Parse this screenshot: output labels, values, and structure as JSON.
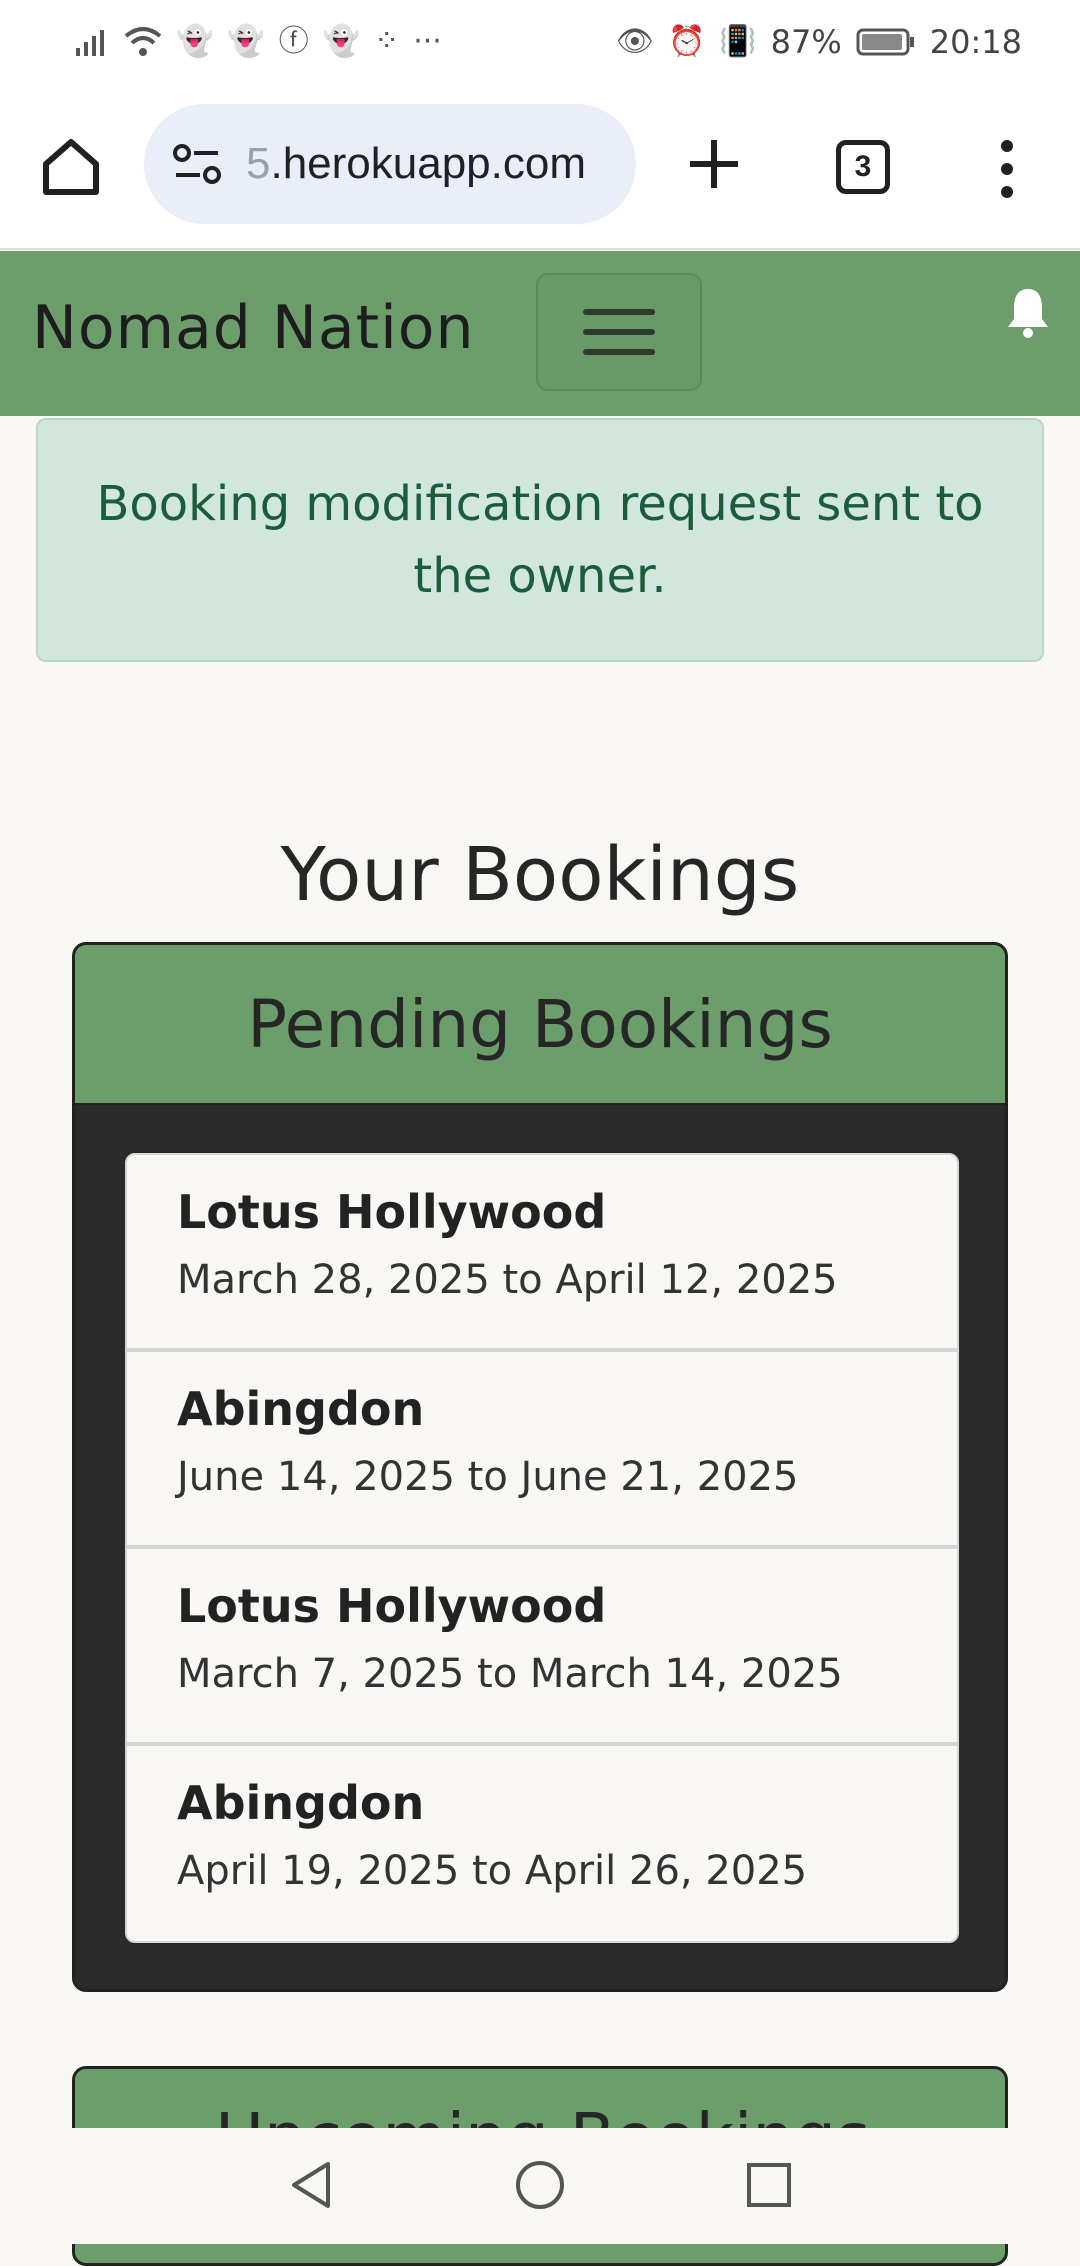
{
  "status_bar": {
    "battery": "87%",
    "time": "20:18",
    "more_notifications": "···"
  },
  "browser": {
    "url_prefix": "5",
    "url_domain": ".herokuapp.com",
    "tab_count": "3"
  },
  "navbar": {
    "brand": "Nomad Nation"
  },
  "alert": {
    "message": "Booking modification request sent to the owner."
  },
  "main": {
    "title": "Your Bookings",
    "pending": {
      "header": "Pending Bookings",
      "items": [
        {
          "name": "Lotus Hollywood",
          "dates": "March 28, 2025 to April 12, 2025"
        },
        {
          "name": "Abingdon",
          "dates": "June 14, 2025 to June 21, 2025"
        },
        {
          "name": "Lotus Hollywood",
          "dates": "March 7, 2025 to March 14, 2025"
        },
        {
          "name": "Abingdon",
          "dates": "April 19, 2025 to April 26, 2025"
        }
      ]
    },
    "upcoming": {
      "header": "Upcoming Bookings"
    }
  },
  "colors": {
    "navbar_green": "#6b9e6b",
    "alert_bg": "#d1e7dd",
    "alert_text": "#1a5c3b",
    "card_dark": "#2b2b2b"
  },
  "icons": {
    "home": "home-icon",
    "site_settings": "tune-icon",
    "new_tab": "plus-icon",
    "menu": "more-vert-icon",
    "bell": "bell-icon"
  }
}
